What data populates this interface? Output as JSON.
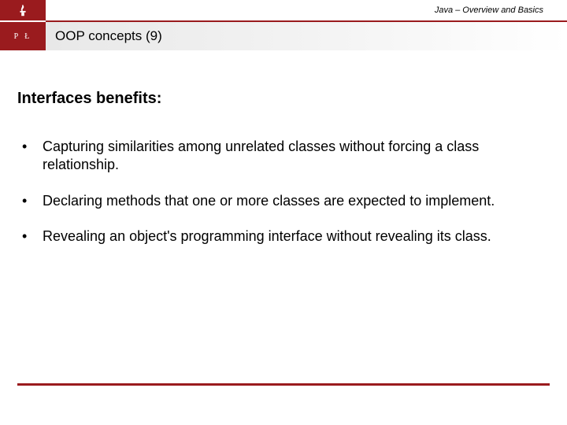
{
  "header": {
    "breadcrumb": "Java – Overview and Basics",
    "logo_text": "P Ł"
  },
  "slide": {
    "title": "OOP concepts (9)",
    "heading": "Interfaces benefits:",
    "bullets": [
      "Capturing similarities among unrelated classes without forcing a class relationship.",
      "Declaring methods that one or more classes are expected to implement.",
      "Revealing an object's programming interface without revealing its class."
    ]
  },
  "colors": {
    "accent": "#9a1b1e"
  }
}
